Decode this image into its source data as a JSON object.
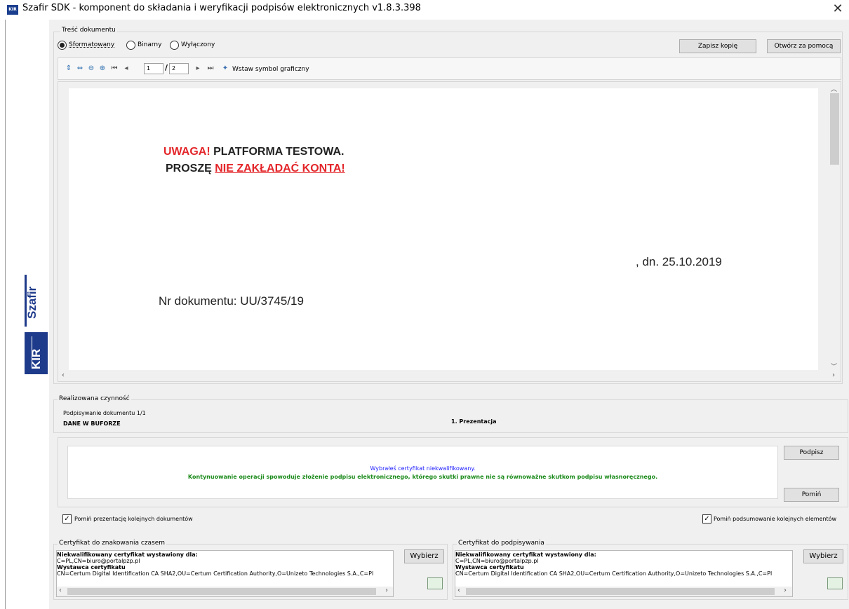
{
  "window": {
    "title": "Szafir SDK - komponent do składania i weryfikacji podpisów elektronicznych v1.8.3.398",
    "app_icon_text": "KIR",
    "close_glyph": "✕"
  },
  "branding": {
    "product": "Szafir",
    "logo": "KIR"
  },
  "document_section": {
    "label": "Treść dokumentu",
    "formats": [
      {
        "label": "Sformatowany",
        "selected": true
      },
      {
        "label": "Binarny",
        "selected": false
      },
      {
        "label": "Wyłączony",
        "selected": false
      }
    ],
    "save_copy_label": "Zapisz kopię",
    "open_with_label": "Otwórz za pomocą"
  },
  "toolbar": {
    "current_page": "1",
    "total_pages": "2",
    "separator": "/",
    "insert_symbol_label": "Wstaw symbol graficzny"
  },
  "document": {
    "warning_red": "UWAGA!",
    "warning_black": " PLATFORMA TESTOWA.",
    "line2_black": "PROSZĘ ",
    "line2_red": "NIE ZAKŁADAĆ KONTA!",
    "date_text": ", dn. 25.10.2019",
    "doc_number": "Nr dokumentu: UU/3745/19",
    "colors": {
      "red": "#e3262a",
      "black": "#222222"
    }
  },
  "operation": {
    "label": "Realizowana czynność",
    "signing": "Podpisywanie dokumentu 1/1",
    "buffer": "DANE W BUFORZE",
    "step": "1. Prezentacja"
  },
  "message": {
    "line1": "Wybrałeś certyfikat niekwalifikowany.",
    "line2": "Kontynuowanie operacji spowoduje złożenie podpisu elektronicznego, którego skutki prawne nie są równoważne skutkom podpisu własnoręcznego.",
    "line1_color": "#1a1aff",
    "line2_color": "#1a8a1a",
    "sign_label": "Podpisz",
    "skip_label": "Pomiń"
  },
  "options": {
    "skip_presentation": "Pomiń prezentację kolejnych dokumentów",
    "skip_summary": "Pomiń podsumowanie kolejnych elementów",
    "checked_glyph": "✓"
  },
  "cert_timestamp": {
    "label": "Certyfikat do znakowania czasem",
    "issued_for_title": "Niekwalifikowany certyfikat wystawiony dla:",
    "issued_for": "C=PL,CN=biuro@portalpzp.pl",
    "issuer_title": "Wystawca certyfikatu",
    "issuer": "CN=Certum Digital Identification CA SHA2,OU=Certum Certification Authority,O=Unizeto Technologies S.A.,C=Pl",
    "choose_label": "Wybierz"
  },
  "cert_signing": {
    "label": "Certyfikat do podpisywania",
    "issued_for_title": "Niekwalifikowany certyfikat wystawiony dla:",
    "issued_for": "C=PL,CN=biuro@portalpzp.pl",
    "issuer_title": "Wystawca certyfikatu",
    "issuer": "CN=Certum Digital Identification CA SHA2,OU=Certum Certification Authority,O=Unizeto Technologies S.A.,C=Pl",
    "choose_label": "Wybierz"
  }
}
